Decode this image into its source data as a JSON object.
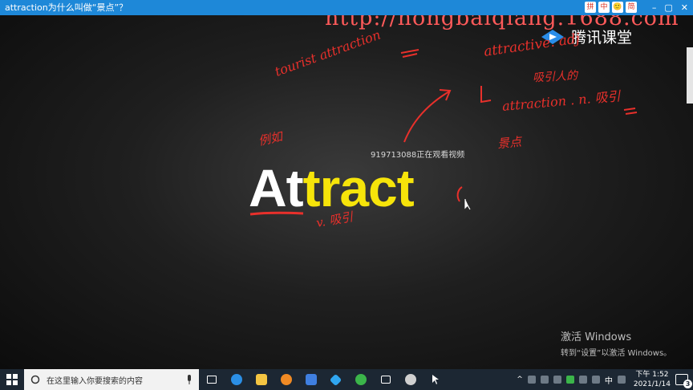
{
  "window": {
    "title": "attraction为什么叫做“景点”？",
    "tool_icons": [
      "拼",
      "中",
      "🙂",
      "简"
    ],
    "controls": [
      "–",
      "▢",
      "✕"
    ]
  },
  "slide": {
    "watermark": "http://hongbaiqiang.1688.com",
    "brand": "腾讯课堂",
    "viewer_notice": "919713088正在观看视频",
    "word_white": "At",
    "word_yellow": "tract",
    "annotations": {
      "tourist": "tourist attraction",
      "adj": "attractive. adj",
      "adj_cn": "吸引人的",
      "noun": "attraction . n. 吸引",
      "noun_cn": "景点",
      "example_cn": "例如",
      "verb": "v. 吸引"
    },
    "activation": {
      "line1": "激活 Windows",
      "line2": "转到“设置”以激活 Windows。"
    }
  },
  "taskbar": {
    "search_placeholder": "在这里输入你要搜索的内容",
    "tray_lang": "中",
    "time": "下午 1:52",
    "date": "2021/1/14",
    "notification_count": "3"
  },
  "colors": {
    "titlebar": "#1e88d8",
    "handwriting": "#e8302b",
    "highlight_yellow": "#f6e40a",
    "taskbar": "#1c2733"
  }
}
